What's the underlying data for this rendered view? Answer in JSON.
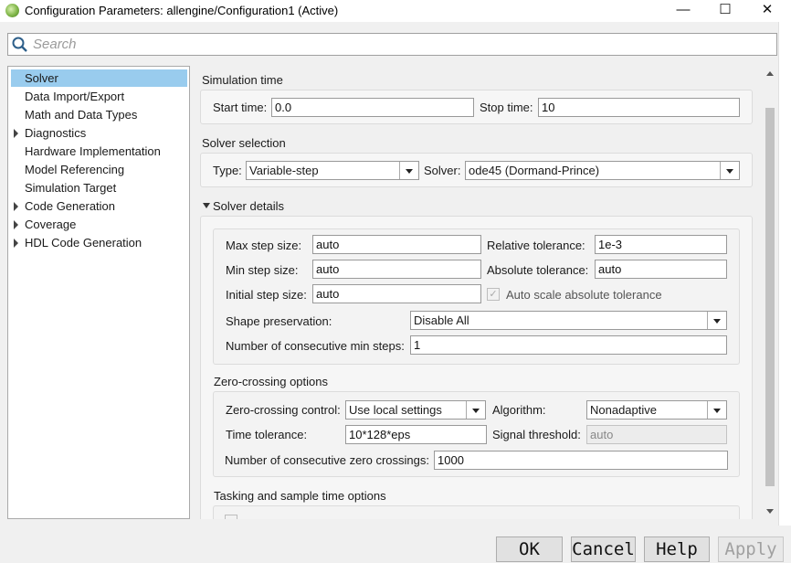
{
  "window": {
    "title": "Configuration Parameters: allengine/Configuration1 (Active)",
    "minimize_glyph": "—",
    "maximize_glyph": "☐",
    "close_glyph": "✕"
  },
  "search": {
    "placeholder": "Search"
  },
  "tree": {
    "items": [
      {
        "label": "Solver",
        "selected": true,
        "expandable": false
      },
      {
        "label": "Data Import/Export",
        "selected": false,
        "expandable": false
      },
      {
        "label": "Math and Data Types",
        "selected": false,
        "expandable": false
      },
      {
        "label": "Diagnostics",
        "selected": false,
        "expandable": true
      },
      {
        "label": "Hardware Implementation",
        "selected": false,
        "expandable": false
      },
      {
        "label": "Model Referencing",
        "selected": false,
        "expandable": false
      },
      {
        "label": "Simulation Target",
        "selected": false,
        "expandable": false
      },
      {
        "label": "Code Generation",
        "selected": false,
        "expandable": true
      },
      {
        "label": "Coverage",
        "selected": false,
        "expandable": true
      },
      {
        "label": "HDL Code Generation",
        "selected": false,
        "expandable": true
      }
    ]
  },
  "sim_time": {
    "heading": "Simulation time",
    "start_label": "Start time:",
    "start_value": "0.0",
    "stop_label": "Stop time:",
    "stop_value": "10"
  },
  "solver_sel": {
    "heading": "Solver selection",
    "type_label": "Type:",
    "type_value": "Variable-step",
    "solver_label": "Solver:",
    "solver_value": "ode45 (Dormand-Prince)"
  },
  "solver_details": {
    "heading": "Solver details",
    "max_step_label": "Max step size:",
    "max_step_value": "auto",
    "min_step_label": "Min step size:",
    "min_step_value": "auto",
    "init_step_label": "Initial step size:",
    "init_step_value": "auto",
    "rel_tol_label": "Relative tolerance:",
    "rel_tol_value": "1e-3",
    "abs_tol_label": "Absolute tolerance:",
    "abs_tol_value": "auto",
    "auto_scale_label": "Auto scale absolute tolerance",
    "shape_label": "Shape preservation:",
    "shape_value": "Disable All",
    "consec_min_label": "Number of consecutive min steps:",
    "consec_min_value": "1"
  },
  "zero_crossing": {
    "heading": "Zero-crossing options",
    "control_label": "Zero-crossing control:",
    "control_value": "Use local settings",
    "algorithm_label": "Algorithm:",
    "algorithm_value": "Nonadaptive",
    "time_tol_label": "Time tolerance:",
    "time_tol_value": "10*128*eps",
    "signal_thr_label": "Signal threshold:",
    "signal_thr_value": "auto",
    "consec_zc_label": "Number of consecutive zero crossings:",
    "consec_zc_value": "1000"
  },
  "tasking": {
    "heading": "Tasking and sample time options"
  },
  "buttons": {
    "ok": "OK",
    "cancel": "Cancel",
    "help": "Help",
    "apply": "Apply"
  }
}
